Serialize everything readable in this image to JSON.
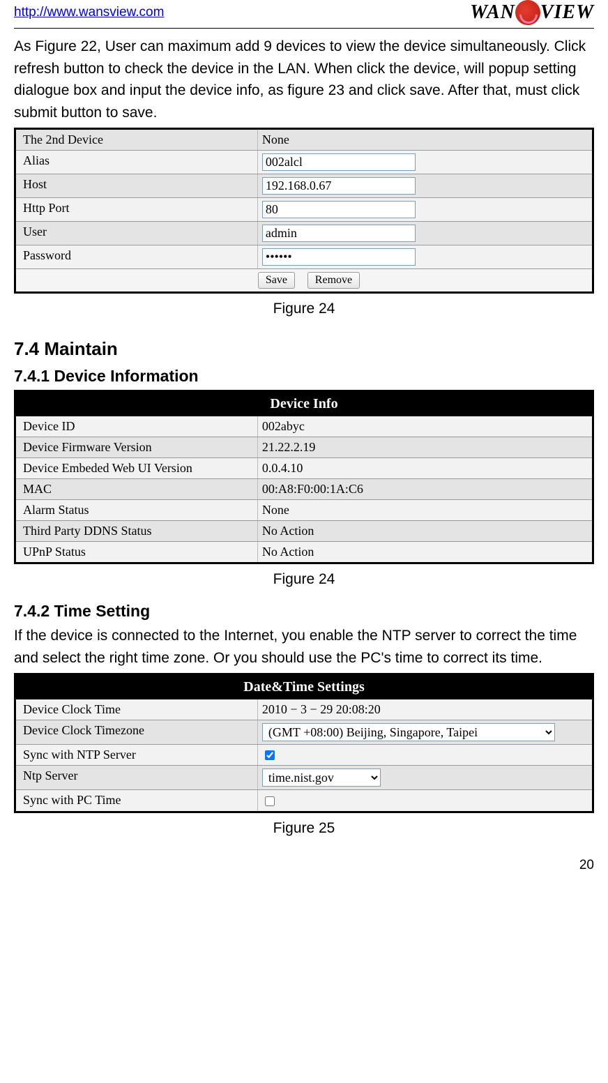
{
  "header": {
    "url": "http://www.wansview.com",
    "logo_left": "WAN",
    "logo_right": "VIEW"
  },
  "intro_paragraph": "As Figure 22, User can maximum add 9 devices to view the device simultaneously. Click refresh button to check the device in the LAN. When click the device, will popup setting dialogue box and input the device info, as figure 23 and click save. After that, must click submit button to save.",
  "fig24a": {
    "rows": [
      {
        "label": "The 2nd Device",
        "value_text": "None",
        "type": "text-header"
      },
      {
        "label": "Alias",
        "value": "002alcl",
        "type": "input"
      },
      {
        "label": "Host",
        "value": "192.168.0.67",
        "type": "input"
      },
      {
        "label": "Http Port",
        "value": "80",
        "type": "input"
      },
      {
        "label": "User",
        "value": "admin",
        "type": "input"
      },
      {
        "label": "Password",
        "value": "••••••",
        "type": "password"
      }
    ],
    "btn_save": "Save",
    "btn_remove": "Remove",
    "caption": "Figure 24"
  },
  "section_74": "7.4  Maintain",
  "section_741": "7.4.1  Device Information",
  "device_info": {
    "title": "Device Info",
    "rows": [
      {
        "label": "Device ID",
        "value": "002abyc"
      },
      {
        "label": "Device Firmware Version",
        "value": "21.22.2.19"
      },
      {
        "label": "Device Embeded Web UI Version",
        "value": "0.0.4.10"
      },
      {
        "label": "MAC",
        "value": "00:A8:F0:00:1A:C6"
      },
      {
        "label": "Alarm Status",
        "value": "None"
      },
      {
        "label": "Third Party DDNS Status",
        "value": "No Action"
      },
      {
        "label": "UPnP Status",
        "value": "No Action"
      }
    ],
    "caption": "Figure 24"
  },
  "section_742": "7.4.2  Time Setting",
  "time_paragraph": "If the device is connected to the Internet, you enable the NTP server to correct the time and select the right time zone. Or you should use the PC's time to correct its time.",
  "datetime": {
    "title": "Date&Time Settings",
    "rows": {
      "clock_time_label": "Device Clock Time",
      "clock_time_value": "2010 − 3 − 29     20:08:20",
      "timezone_label": "Device Clock Timezone",
      "timezone_value": "(GMT +08:00) Beijing, Singapore, Taipei",
      "sync_ntp_label": "Sync with NTP Server",
      "sync_ntp_checked": true,
      "ntp_server_label": "Ntp Server",
      "ntp_server_value": "time.nist.gov",
      "sync_pc_label": "Sync with PC Time",
      "sync_pc_checked": false
    },
    "caption": "Figure 25"
  },
  "page_number": "20"
}
